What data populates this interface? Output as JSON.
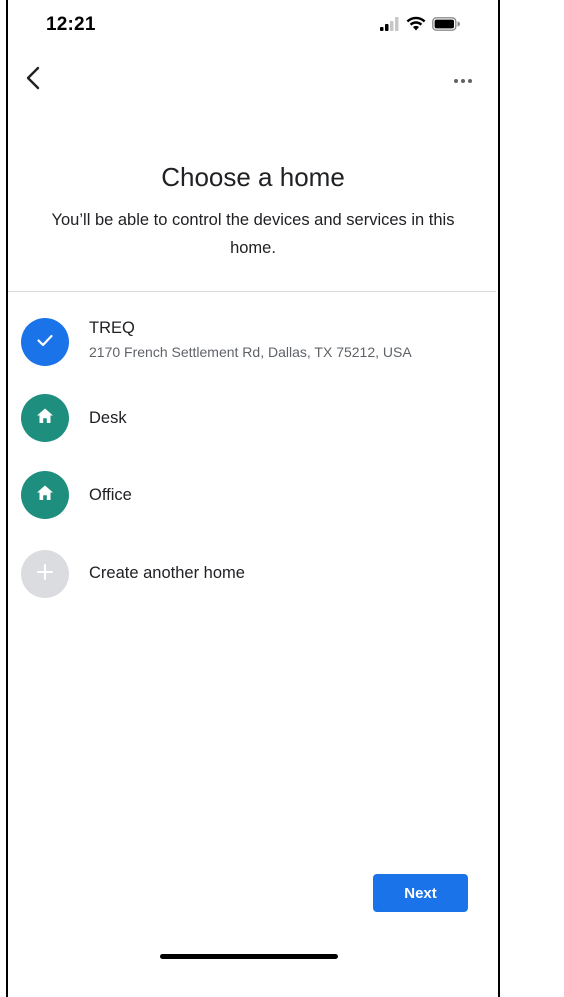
{
  "status_bar": {
    "time": "12:21",
    "icons": [
      "cellular-signal-icon",
      "wifi-icon",
      "battery-icon"
    ]
  },
  "nav": {
    "back_icon": "chevron-left-icon",
    "more_icon": "more-horizontal-icon"
  },
  "header": {
    "title": "Choose a home",
    "subtitle": "You’ll be able to control the devices and services in this home."
  },
  "homes": [
    {
      "name": "TREQ",
      "address": "2170 French Settlement Rd, Dallas, TX 75212, USA",
      "icon": "check-icon",
      "selected": true
    },
    {
      "name": "Desk",
      "icon": "home-icon",
      "selected": false
    },
    {
      "name": "Office",
      "icon": "home-icon",
      "selected": false
    },
    {
      "name": "Create another home",
      "icon": "plus-icon",
      "selected": false
    }
  ],
  "footer": {
    "next_label": "Next"
  },
  "colors": {
    "accent": "#1a73e8",
    "home_avatar": "#1e8e7e",
    "add_avatar": "#dadce0",
    "divider": "#dadce0",
    "secondary_text": "#5f6368"
  }
}
